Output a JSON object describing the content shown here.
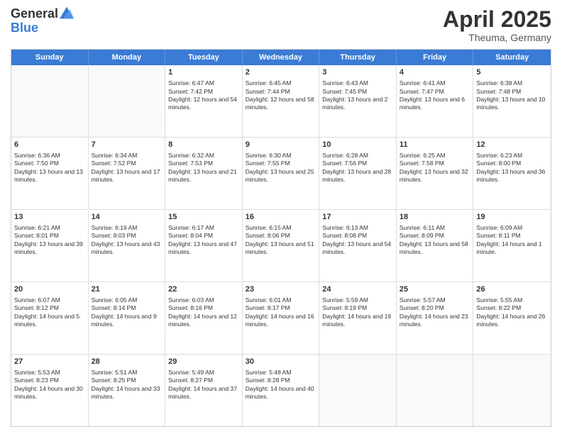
{
  "logo": {
    "line1": "General",
    "line2": "Blue"
  },
  "title": "April 2025",
  "subtitle": "Theuma, Germany",
  "days_of_week": [
    "Sunday",
    "Monday",
    "Tuesday",
    "Wednesday",
    "Thursday",
    "Friday",
    "Saturday"
  ],
  "weeks": [
    [
      {
        "day": "",
        "empty": true
      },
      {
        "day": "",
        "empty": true
      },
      {
        "day": "1",
        "sunrise": "Sunrise: 6:47 AM",
        "sunset": "Sunset: 7:42 PM",
        "daylight": "Daylight: 12 hours and 54 minutes."
      },
      {
        "day": "2",
        "sunrise": "Sunrise: 6:45 AM",
        "sunset": "Sunset: 7:44 PM",
        "daylight": "Daylight: 12 hours and 58 minutes."
      },
      {
        "day": "3",
        "sunrise": "Sunrise: 6:43 AM",
        "sunset": "Sunset: 7:45 PM",
        "daylight": "Daylight: 13 hours and 2 minutes."
      },
      {
        "day": "4",
        "sunrise": "Sunrise: 6:41 AM",
        "sunset": "Sunset: 7:47 PM",
        "daylight": "Daylight: 13 hours and 6 minutes."
      },
      {
        "day": "5",
        "sunrise": "Sunrise: 6:38 AM",
        "sunset": "Sunset: 7:48 PM",
        "daylight": "Daylight: 13 hours and 10 minutes."
      }
    ],
    [
      {
        "day": "6",
        "sunrise": "Sunrise: 6:36 AM",
        "sunset": "Sunset: 7:50 PM",
        "daylight": "Daylight: 13 hours and 13 minutes."
      },
      {
        "day": "7",
        "sunrise": "Sunrise: 6:34 AM",
        "sunset": "Sunset: 7:52 PM",
        "daylight": "Daylight: 13 hours and 17 minutes."
      },
      {
        "day": "8",
        "sunrise": "Sunrise: 6:32 AM",
        "sunset": "Sunset: 7:53 PM",
        "daylight": "Daylight: 13 hours and 21 minutes."
      },
      {
        "day": "9",
        "sunrise": "Sunrise: 6:30 AM",
        "sunset": "Sunset: 7:55 PM",
        "daylight": "Daylight: 13 hours and 25 minutes."
      },
      {
        "day": "10",
        "sunrise": "Sunrise: 6:28 AM",
        "sunset": "Sunset: 7:56 PM",
        "daylight": "Daylight: 13 hours and 28 minutes."
      },
      {
        "day": "11",
        "sunrise": "Sunrise: 6:25 AM",
        "sunset": "Sunset: 7:58 PM",
        "daylight": "Daylight: 13 hours and 32 minutes."
      },
      {
        "day": "12",
        "sunrise": "Sunrise: 6:23 AM",
        "sunset": "Sunset: 8:00 PM",
        "daylight": "Daylight: 13 hours and 36 minutes."
      }
    ],
    [
      {
        "day": "13",
        "sunrise": "Sunrise: 6:21 AM",
        "sunset": "Sunset: 8:01 PM",
        "daylight": "Daylight: 13 hours and 39 minutes."
      },
      {
        "day": "14",
        "sunrise": "Sunrise: 6:19 AM",
        "sunset": "Sunset: 8:03 PM",
        "daylight": "Daylight: 13 hours and 43 minutes."
      },
      {
        "day": "15",
        "sunrise": "Sunrise: 6:17 AM",
        "sunset": "Sunset: 8:04 PM",
        "daylight": "Daylight: 13 hours and 47 minutes."
      },
      {
        "day": "16",
        "sunrise": "Sunrise: 6:15 AM",
        "sunset": "Sunset: 8:06 PM",
        "daylight": "Daylight: 13 hours and 51 minutes."
      },
      {
        "day": "17",
        "sunrise": "Sunrise: 6:13 AM",
        "sunset": "Sunset: 8:08 PM",
        "daylight": "Daylight: 13 hours and 54 minutes."
      },
      {
        "day": "18",
        "sunrise": "Sunrise: 6:11 AM",
        "sunset": "Sunset: 8:09 PM",
        "daylight": "Daylight: 13 hours and 58 minutes."
      },
      {
        "day": "19",
        "sunrise": "Sunrise: 6:09 AM",
        "sunset": "Sunset: 8:11 PM",
        "daylight": "Daylight: 14 hours and 1 minute."
      }
    ],
    [
      {
        "day": "20",
        "sunrise": "Sunrise: 6:07 AM",
        "sunset": "Sunset: 8:12 PM",
        "daylight": "Daylight: 14 hours and 5 minutes."
      },
      {
        "day": "21",
        "sunrise": "Sunrise: 6:05 AM",
        "sunset": "Sunset: 8:14 PM",
        "daylight": "Daylight: 14 hours and 9 minutes."
      },
      {
        "day": "22",
        "sunrise": "Sunrise: 6:03 AM",
        "sunset": "Sunset: 8:16 PM",
        "daylight": "Daylight: 14 hours and 12 minutes."
      },
      {
        "day": "23",
        "sunrise": "Sunrise: 6:01 AM",
        "sunset": "Sunset: 8:17 PM",
        "daylight": "Daylight: 14 hours and 16 minutes."
      },
      {
        "day": "24",
        "sunrise": "Sunrise: 5:59 AM",
        "sunset": "Sunset: 8:19 PM",
        "daylight": "Daylight: 14 hours and 19 minutes."
      },
      {
        "day": "25",
        "sunrise": "Sunrise: 5:57 AM",
        "sunset": "Sunset: 8:20 PM",
        "daylight": "Daylight: 14 hours and 23 minutes."
      },
      {
        "day": "26",
        "sunrise": "Sunrise: 5:55 AM",
        "sunset": "Sunset: 8:22 PM",
        "daylight": "Daylight: 14 hours and 26 minutes."
      }
    ],
    [
      {
        "day": "27",
        "sunrise": "Sunrise: 5:53 AM",
        "sunset": "Sunset: 8:23 PM",
        "daylight": "Daylight: 14 hours and 30 minutes."
      },
      {
        "day": "28",
        "sunrise": "Sunrise: 5:51 AM",
        "sunset": "Sunset: 8:25 PM",
        "daylight": "Daylight: 14 hours and 33 minutes."
      },
      {
        "day": "29",
        "sunrise": "Sunrise: 5:49 AM",
        "sunset": "Sunset: 8:27 PM",
        "daylight": "Daylight: 14 hours and 37 minutes."
      },
      {
        "day": "30",
        "sunrise": "Sunrise: 5:48 AM",
        "sunset": "Sunset: 8:28 PM",
        "daylight": "Daylight: 14 hours and 40 minutes."
      },
      {
        "day": "",
        "empty": true
      },
      {
        "day": "",
        "empty": true
      },
      {
        "day": "",
        "empty": true
      }
    ]
  ]
}
